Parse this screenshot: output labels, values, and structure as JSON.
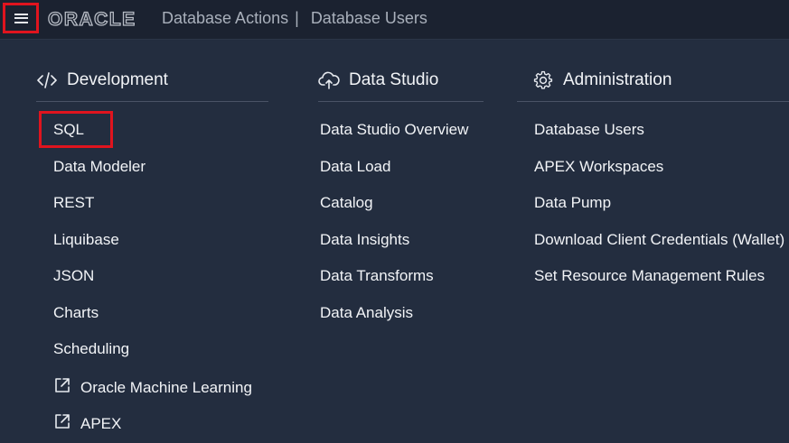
{
  "header": {
    "menu_icon": "hamburger-icon",
    "brand": "ORACLE",
    "app": "Database Actions",
    "separator": "|",
    "page": "Database Users"
  },
  "development": {
    "title": "Development",
    "icon": "code-icon",
    "items": [
      {
        "label": "SQL"
      },
      {
        "label": "Data Modeler"
      },
      {
        "label": "REST"
      },
      {
        "label": "Liquibase"
      },
      {
        "label": "JSON"
      },
      {
        "label": "Charts"
      },
      {
        "label": "Scheduling"
      },
      {
        "label": "Oracle Machine Learning",
        "icon": "external-link-icon"
      },
      {
        "label": "APEX",
        "icon": "external-link-icon"
      }
    ]
  },
  "data_studio": {
    "title": "Data Studio",
    "icon": "cloud-upload-icon",
    "items": [
      {
        "label": "Data Studio Overview"
      },
      {
        "label": "Data Load"
      },
      {
        "label": "Catalog"
      },
      {
        "label": "Data Insights"
      },
      {
        "label": "Data Transforms"
      },
      {
        "label": "Data Analysis"
      }
    ]
  },
  "administration": {
    "title": "Administration",
    "icon": "gear-icon",
    "items": [
      {
        "label": "Database Users"
      },
      {
        "label": "APEX Workspaces"
      },
      {
        "label": "Data Pump"
      },
      {
        "label": "Download Client Credentials (Wallet)"
      },
      {
        "label": "Set Resource Management Rules"
      }
    ]
  },
  "colors": {
    "background": "#232d3f",
    "header": "#1b2230",
    "highlight": "#e0141e"
  }
}
